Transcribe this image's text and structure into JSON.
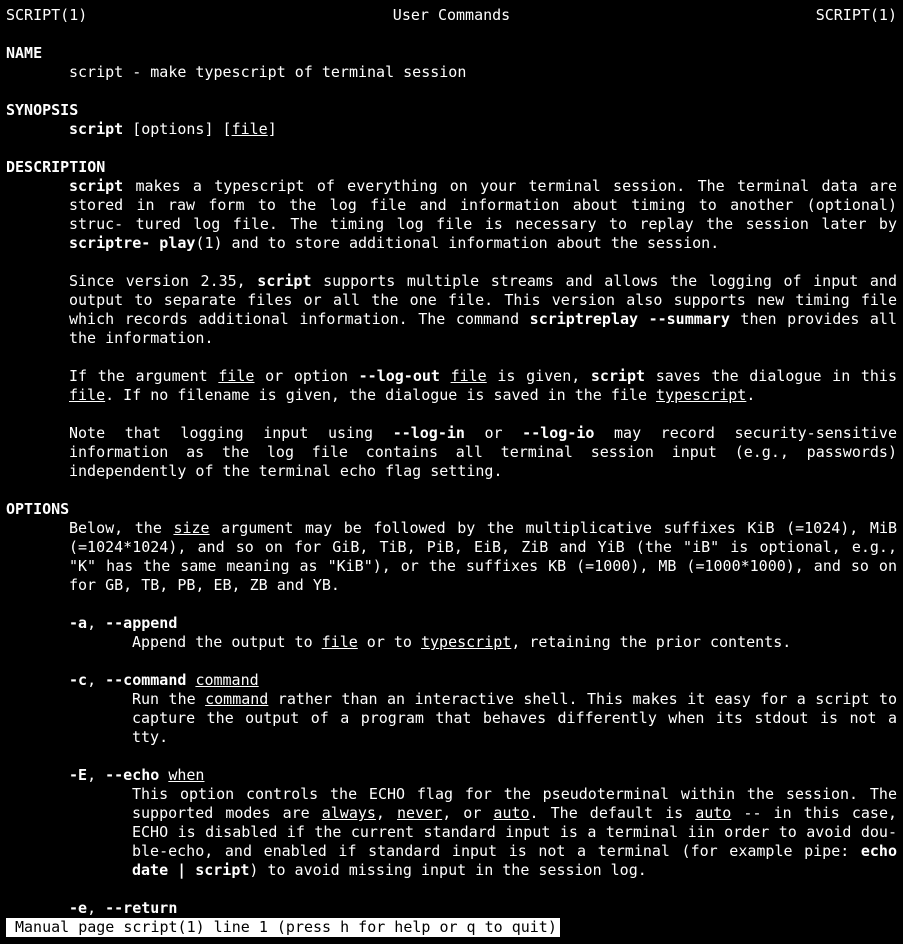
{
  "header": {
    "left": "SCRIPT(1)",
    "center": "User Commands",
    "right": "SCRIPT(1)"
  },
  "sections": {
    "name": "NAME",
    "synopsis": "SYNOPSIS",
    "description": "DESCRIPTION",
    "options": "OPTIONS"
  },
  "name_line": "script - make typescript of terminal session",
  "synopsis": {
    "cmd": "script",
    "opts": " [options] [",
    "file": "file",
    "close": "]"
  },
  "desc": {
    "p1_a": "script",
    "p1_b": "  makes  a  typescript  of everything on your terminal session.  The terminal data are stored in raw form to the log file and information about timing to another (optional) struc‐ tured  log  file.  The timing log file is necessary to replay the session later by ",
    "p1_c": "scriptre‐ play",
    "p1_d": "(1) and to store additional information about the session.",
    "p2_a": "Since version 2.35, ",
    "p2_b": "script",
    "p2_c": " supports multiple streams and allows the  logging  of  input  and output  to  separate  files or all the one file.  This version also supports new timing file which records additional information.  The command ",
    "p2_d": "scriptreplay --summary",
    "p2_e": " then provides  all the information.",
    "p3_a": "If  the  argument  ",
    "p3_file1": "file",
    "p3_b": " or option ",
    "p3_c": "--log-out",
    "p3_sp": " ",
    "p3_file2": "file",
    "p3_d": " is given, ",
    "p3_e": "script",
    "p3_f": " saves the dialogue in this ",
    "p3_file3": "file",
    "p3_g": ".  If no filename is given, the dialogue is saved in the file ",
    "p3_ts": "typescript",
    "p3_h": ".",
    "p4_a": "Note that logging input using ",
    "p4_b": "--log-in",
    "p4_c": " or ",
    "p4_d": "--log-io",
    "p4_e": " may record security-sensitive information as  the  log file contains all terminal session input (e.g., passwords) independently of the terminal echo flag setting."
  },
  "options": {
    "intro_a": "Below, the ",
    "intro_size": "size",
    "intro_b": " argument may be followed by the multiplicative  suffixes  KiB  (=1024),  MiB (=1024*1024), and so on for GiB, TiB, PiB, EiB, ZiB and YiB (the \"iB\" is optional, e.g., \"K\" has the same meaning as \"KiB\"), or the suffixes KB (=1000), MB (=1000*1000), and so  on  for GB, TB, PB, EB, ZB and YB.",
    "a_short": "-a",
    "a_sep": ", ",
    "a_long": "--append",
    "a_desc_a": "Append the output to ",
    "a_file": "file",
    "a_desc_b": " or to ",
    "a_ts": "typescript",
    "a_desc_c": ", retaining the prior contents.",
    "c_short": "-c",
    "c_sep": ", ",
    "c_long": "--command",
    "c_sp": " ",
    "c_arg": "command",
    "c_desc_a": "Run the ",
    "c_cmd": "command",
    "c_desc_b": " rather than an interactive shell.  This makes it easy for a script to capture the output of a program that behaves differently when its  stdout  is  not  a tty.",
    "E_short": "-E",
    "E_sep": ", ",
    "E_long": "--echo",
    "E_sp": " ",
    "E_arg": "when",
    "E_desc_a": "This  option  controls  the ECHO flag for the pseudoterminal within the session.  The supported modes are ",
    "E_always": "always",
    "E_c1": ", ",
    "E_never": "never",
    "E_c2": ", or ",
    "E_auto1": "auto",
    "E_desc_b": ".  The default is ",
    "E_auto2": "auto",
    "E_desc_c": "  --  in  this  case, ECHO  is disabled if the current standard input is a terminal iin order to avoid dou‐ ble-echo, and enabled if standard input is not a terminal  (for  example  pipe:  ",
    "E_echo": "echo date | script",
    "E_desc_d": ") to avoid missing input in the session log.",
    "e_short": "-e",
    "e_sep": ", ",
    "e_long": "--return"
  },
  "status": "Manual page script(1) line 1 (press h for help or q to quit)"
}
